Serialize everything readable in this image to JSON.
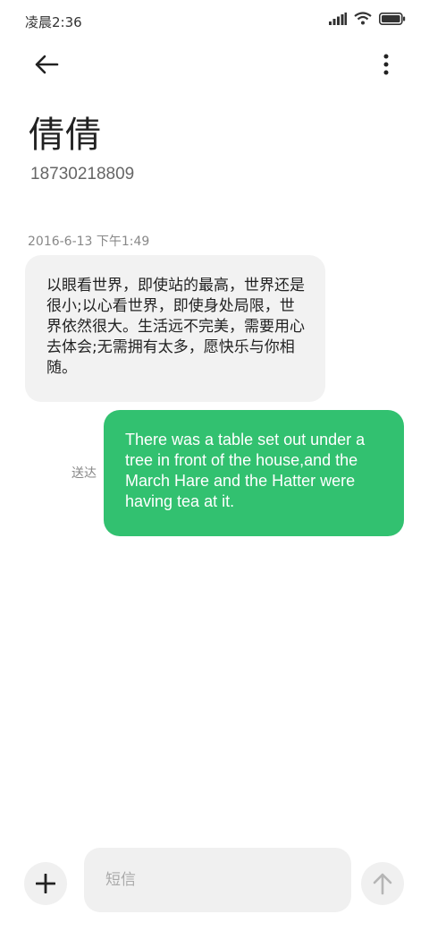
{
  "status_bar": {
    "time": "凌晨2:36",
    "icons": [
      "signal-icon",
      "wifi-icon",
      "battery-icon"
    ]
  },
  "header": {
    "back_icon": "back-arrow-icon",
    "more_icon": "more-vertical-icon",
    "contact_name": "倩倩",
    "contact_number": "18730218809"
  },
  "conversation": {
    "timestamp": "2016-6-13 下午1:49",
    "messages": [
      {
        "direction": "incoming",
        "text": "以眼看世界，即使站的最高，世界还是很小;以心看世界，即使身处局限，世界依然很大。生活远不完美，需要用心去体会;无需拥有太多，愿快乐与你相随。"
      },
      {
        "direction": "outgoing",
        "text": "There was a table set out under a tree in front of the house,and the March Hare and the Hatter were having tea at it.",
        "status": "送达"
      }
    ]
  },
  "composer": {
    "add_icon": "plus-icon",
    "placeholder": "短信",
    "send_icon": "send-arrow-icon"
  },
  "colors": {
    "outgoing_bubble": "#32c170",
    "incoming_bubble": "#f2f2f2",
    "background": "#ffffff"
  }
}
